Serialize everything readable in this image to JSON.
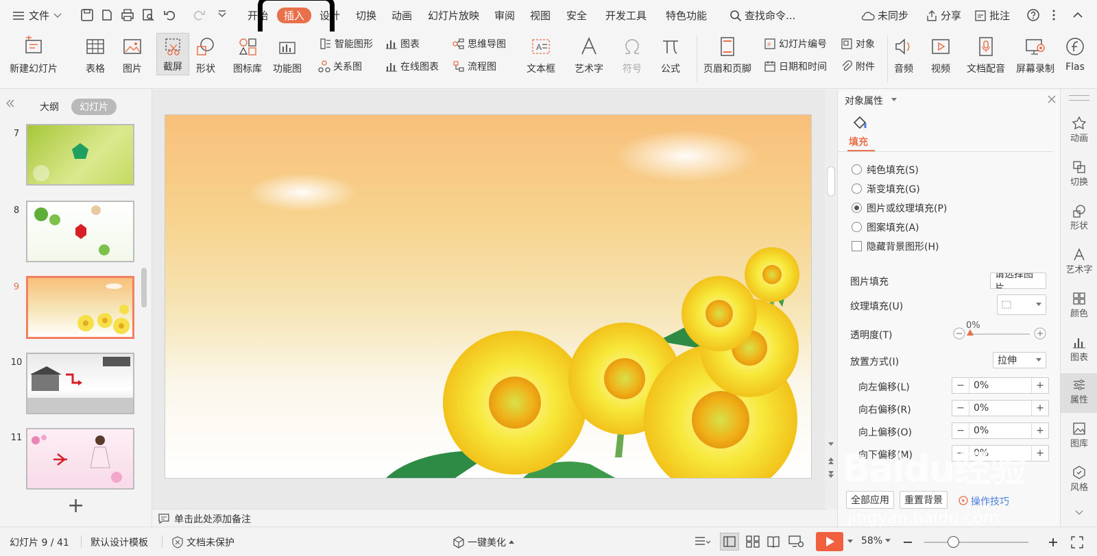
{
  "menubar": {
    "file": "文件",
    "items": [
      "开始",
      "插入",
      "设计",
      "切换",
      "动画",
      "幻灯片放映",
      "审阅",
      "视图",
      "安全",
      "开发工具",
      "特色功能"
    ],
    "search": "查找命令...",
    "right": {
      "sync": "未同步",
      "share": "分享",
      "annotate": "批注"
    }
  },
  "ribbon": {
    "new_slide": "新建幻灯片",
    "table": "表格",
    "picture": "图片",
    "screenshot": "截屏",
    "shape": "形状",
    "icon_lib": "图标库",
    "function_chart": "功能图",
    "smart_shape": "智能图形",
    "chart": "图表",
    "relation": "关系图",
    "online_chart": "在线图表",
    "mindmap": "思维导图",
    "flowchart": "流程图",
    "textbox": "文本框",
    "wordart": "艺术字",
    "symbol": "符号",
    "formula": "公式",
    "header_footer": "页眉和页脚",
    "slide_number": "幻灯片编号",
    "object": "对象",
    "datetime": "日期和时间",
    "attachment": "附件",
    "audio": "音频",
    "video": "视频",
    "doc_audio": "文档配音",
    "screen_record": "屏幕录制",
    "flash": "Flas"
  },
  "leftpanel": {
    "tab_outline": "大纲",
    "tab_slides": "幻灯片",
    "slides": [
      "7",
      "8",
      "9",
      "10",
      "11"
    ],
    "add": "+"
  },
  "notes": "单击此处添加备注",
  "rightpanel": {
    "title": "对象属性",
    "tab_fill": "填充",
    "options": [
      "纯色填充(S)",
      "渐变填充(G)",
      "图片或纹理填充(P)",
      "图案填充(A)"
    ],
    "hide_bg": "隐藏背景图形(H)",
    "picture_fill": "图片填充",
    "picture_fill_btn": "请选择图片",
    "texture_fill": "纹理填充(U)",
    "transparency": "透明度(T)",
    "transparency_value": "0%",
    "placement": "放置方式(I)",
    "placement_value": "拉伸",
    "offsets": [
      {
        "label": "向左偏移(L)",
        "value": "0%"
      },
      {
        "label": "向右偏移(R)",
        "value": "0%"
      },
      {
        "label": "向上偏移(O)",
        "value": "0%"
      },
      {
        "label": "向下偏移(M)",
        "value": "0%"
      }
    ],
    "apply_all": "全部应用",
    "reset_bg": "重置背景",
    "tips": "操作技巧"
  },
  "sidebar": [
    "动画",
    "切换",
    "形状",
    "艺术字",
    "颜色",
    "图表",
    "属性",
    "图库",
    "风格"
  ],
  "statusbar": {
    "slide_info": "幻灯片 9 / 41",
    "template": "默认设计模板",
    "protect": "文档未保护",
    "beautify": "一键美化",
    "zoom": "58%"
  },
  "watermark": {
    "text": "Baidu经验",
    "url": "jingyan.baidu.com"
  },
  "colors": {
    "accent": "#e8704a"
  }
}
